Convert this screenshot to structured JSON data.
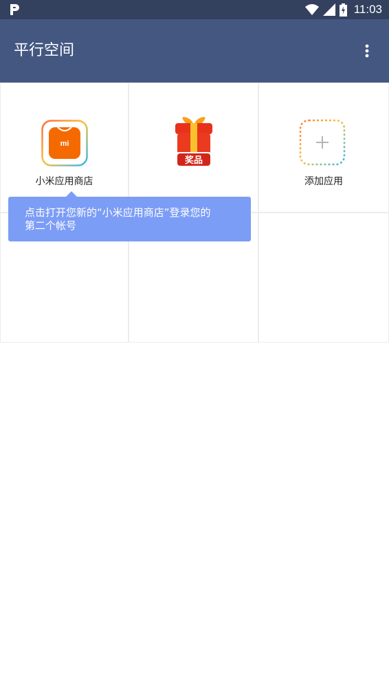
{
  "status_bar": {
    "left_icon": "p-logo-icon",
    "icons": [
      "wifi-icon",
      "cell-signal-icon",
      "battery-charging-icon"
    ],
    "time": "11:03"
  },
  "app_bar": {
    "title": "平行空间",
    "menu_icon": "more-vert-icon"
  },
  "grid": {
    "apps": [
      {
        "label": "小米应用商店",
        "icon": "mi-store-icon"
      },
      {
        "label": "",
        "icon": "gift-icon",
        "badge": "奖品"
      },
      {
        "label": "添加应用",
        "icon": "add-icon"
      }
    ]
  },
  "tooltip": {
    "line1": "点击打开您新的“小米应用商店”登录您的",
    "line2": "第二个帐号"
  },
  "colors": {
    "status_bar": "#33415f",
    "app_bar": "#435781",
    "tooltip": "#7c9df6",
    "mi_orange": "#f56a00"
  }
}
